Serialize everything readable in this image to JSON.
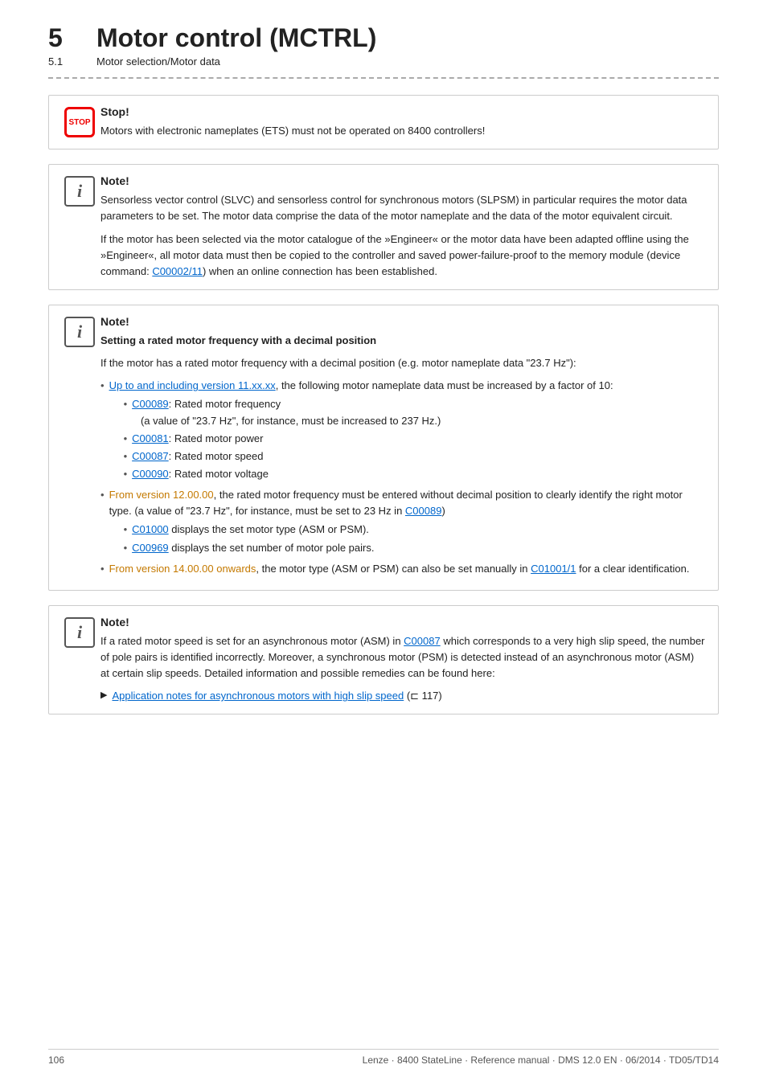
{
  "header": {
    "chapter_number": "5",
    "chapter_title": "Motor control (MCTRL)",
    "subchapter_number": "5.1",
    "subchapter_title": "Motor selection/Motor data"
  },
  "divider": "_ _ _ _ _ _ _ _ _ _ _ _ _ _ _ _ _ _ _ _ _ _ _ _ _ _ _ _ _ _ _ _ _ _ _ _ _ _ _ _ _ _ _ _",
  "stop_box": {
    "heading": "Stop!",
    "body": "Motors with electronic nameplates (ETS) must not be operated on 8400 controllers!"
  },
  "note1_box": {
    "heading": "Note!",
    "para1": "Sensorless vector control (SLVC) and sensorless control for synchronous motors (SLPSM) in particular requires the motor data parameters to be set. The motor data comprise the data of the motor nameplate and the data of the motor equivalent circuit.",
    "para2_prefix": "If the motor has been selected via the motor catalogue of the »Engineer« or the motor data have been adapted offline using the »Engineer«, all motor data must then be copied to the controller and saved power-failure-proof to the memory module (device command: ",
    "para2_link_text": "C00002/11",
    "para2_suffix": ") when an online connection has been established."
  },
  "note2_box": {
    "heading": "Note!",
    "sub_heading": "Setting a rated motor frequency with a decimal position",
    "intro": "If the motor has a rated motor frequency with a decimal position (e.g. motor nameplate data \"23.7 Hz\"):",
    "bullet1_prefix": "Up to and including version 11.xx.xx",
    "bullet1_suffix": ", the following motor nameplate data must be increased by a factor of 10:",
    "subbullets1": [
      {
        "prefix": "",
        "link": "C00089",
        "suffix": ": Rated motor frequency\n(a value of \"23.7 Hz\", for instance, must be increased to 237 Hz.)"
      },
      {
        "prefix": "",
        "link": "C00081",
        "suffix": ": Rated motor power"
      },
      {
        "prefix": "",
        "link": "C00087",
        "suffix": ": Rated motor speed"
      },
      {
        "prefix": "",
        "link": "C00090",
        "suffix": ": Rated motor voltage"
      }
    ],
    "bullet2_prefix": "From version 12.00.00",
    "bullet2_suffix": ", the rated motor frequency must be entered without decimal position to clearly identify the right motor type. (a value of \"23.7 Hz\", for instance, must be set to 23 Hz in ",
    "bullet2_link": "C00089",
    "bullet2_end": ")",
    "subbullets2": [
      {
        "prefix": "",
        "link": "C01000",
        "suffix": " displays the set motor type (ASM or PSM)."
      },
      {
        "prefix": "",
        "link": "C00969",
        "suffix": " displays the set number of motor pole pairs."
      }
    ],
    "bullet3_prefix": "From version 14.00.00 onwards",
    "bullet3_suffix": ", the motor type (ASM or PSM) can also be set manually in ",
    "bullet3_link": "C01001/1",
    "bullet3_end": " for a clear identification."
  },
  "note3_box": {
    "heading": "Note!",
    "para1_prefix": "If a rated motor speed is set for an asynchronous motor (ASM) in ",
    "para1_link": "C00087",
    "para1_suffix": " which corresponds to a very high slip speed, the number of pole pairs is identified incorrectly. Moreover, a synchronous motor (PSM) is detected instead of an asynchronous motor (ASM) at certain slip speeds. Detailed information and possible remedies can be found here:",
    "arrow_link_text": "Application notes for asynchronous motors with high slip speed",
    "arrow_link_suffix": " (⊏ 117)"
  },
  "footer": {
    "page_number": "106",
    "doc_info": "Lenze · 8400 StateLine · Reference manual · DMS 12.0 EN · 06/2014 · TD05/TD14"
  }
}
